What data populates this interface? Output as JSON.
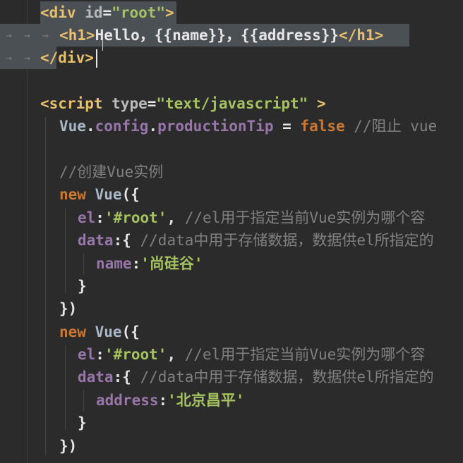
{
  "colors": {
    "background": "#2b2b2b",
    "tag": "#e8bf6a",
    "attribute": "#bababa",
    "string": "#a5c261",
    "keyword": "#cc7832",
    "identifier": "#9876aa",
    "default": "#e6e6e6",
    "comment": "#808080",
    "selection": "#4b5055",
    "class": "#a9b7c6"
  },
  "lines": [
    {
      "tokens": [
        {
          "t": "<div ",
          "c": "tag"
        },
        {
          "t": "id",
          "c": "attribute"
        },
        {
          "t": "=",
          "c": "default"
        },
        {
          "t": "\"root\"",
          "c": "string"
        },
        {
          "t": ">",
          "c": "tag"
        }
      ]
    },
    {
      "tokens": [
        {
          "t": "<h1>",
          "c": "tag"
        },
        {
          "t": "Hello，{{name}}，{{address}}",
          "c": "default"
        },
        {
          "t": "</h1>",
          "c": "tag"
        }
      ]
    },
    {
      "tokens": [
        {
          "t": "</div>",
          "c": "tag"
        }
      ]
    },
    {
      "tokens": []
    },
    {
      "tokens": [
        {
          "t": "<script ",
          "c": "tag"
        },
        {
          "t": "type",
          "c": "attribute"
        },
        {
          "t": "=",
          "c": "default"
        },
        {
          "t": "\"text/javascript\"",
          "c": "string"
        },
        {
          "t": " >",
          "c": "tag"
        }
      ]
    },
    {
      "tokens": [
        {
          "t": "Vue",
          "c": "class"
        },
        {
          "t": ".",
          "c": "default"
        },
        {
          "t": "config",
          "c": "identifier"
        },
        {
          "t": ".",
          "c": "default"
        },
        {
          "t": "productionTip",
          "c": "identifier"
        },
        {
          "t": " = ",
          "c": "default"
        },
        {
          "t": "false",
          "c": "keyword"
        },
        {
          "t": " //阻止 vue",
          "c": "comment"
        }
      ]
    },
    {
      "tokens": []
    },
    {
      "tokens": [
        {
          "t": "//创建Vue实例",
          "c": "comment"
        }
      ]
    },
    {
      "tokens": [
        {
          "t": "new ",
          "c": "keyword"
        },
        {
          "t": "Vue",
          "c": "class"
        },
        {
          "t": "({",
          "c": "default"
        }
      ]
    },
    {
      "tokens": [
        {
          "t": "el",
          "c": "identifier"
        },
        {
          "t": ":",
          "c": "default"
        },
        {
          "t": "'#root'",
          "c": "string"
        },
        {
          "t": ", ",
          "c": "default"
        },
        {
          "t": "//el用于指定当前Vue实例为哪个容",
          "c": "comment"
        }
      ]
    },
    {
      "tokens": [
        {
          "t": "data",
          "c": "identifier"
        },
        {
          "t": ":{ ",
          "c": "default"
        },
        {
          "t": "//data中用于存储数据，数据供el所指定的",
          "c": "comment"
        }
      ]
    },
    {
      "tokens": [
        {
          "t": "name",
          "c": "identifier"
        },
        {
          "t": ":",
          "c": "default"
        },
        {
          "t": "'尚硅谷'",
          "c": "string"
        }
      ]
    },
    {
      "tokens": [
        {
          "t": "}",
          "c": "default"
        }
      ]
    },
    {
      "tokens": [
        {
          "t": "})",
          "c": "default"
        }
      ]
    },
    {
      "tokens": [
        {
          "t": "new ",
          "c": "keyword"
        },
        {
          "t": "Vue",
          "c": "class"
        },
        {
          "t": "({",
          "c": "default"
        }
      ]
    },
    {
      "tokens": [
        {
          "t": "el",
          "c": "identifier"
        },
        {
          "t": ":",
          "c": "default"
        },
        {
          "t": "'#root'",
          "c": "string"
        },
        {
          "t": ", ",
          "c": "default"
        },
        {
          "t": "//el用于指定当前Vue实例为哪个容",
          "c": "comment"
        }
      ]
    },
    {
      "tokens": [
        {
          "t": "data",
          "c": "identifier"
        },
        {
          "t": ":{ ",
          "c": "default"
        },
        {
          "t": "//data中用于存储数据，数据供el所指定的",
          "c": "comment"
        }
      ]
    },
    {
      "tokens": [
        {
          "t": "address",
          "c": "identifier"
        },
        {
          "t": ":",
          "c": "default"
        },
        {
          "t": "'北京昌平'",
          "c": "string"
        }
      ]
    },
    {
      "tokens": [
        {
          "t": "}",
          "c": "default"
        }
      ]
    },
    {
      "tokens": [
        {
          "t": "})",
          "c": "default"
        }
      ]
    }
  ]
}
